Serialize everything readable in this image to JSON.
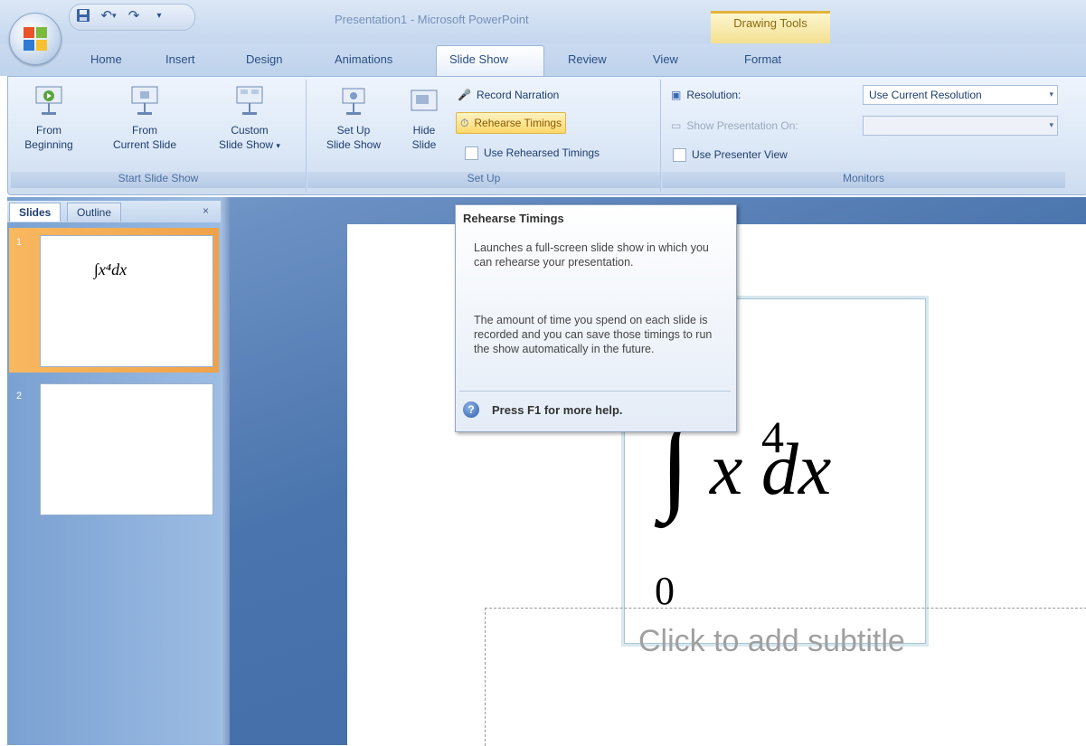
{
  "window": {
    "title": "Presentation1 - Microsoft PowerPoint",
    "contextual_tab_group": "Drawing Tools"
  },
  "quick_access": {
    "icons": [
      "save-icon",
      "undo-icon",
      "redo-icon",
      "customize-icon"
    ],
    "undo_glyph": "↶",
    "undo_arrow": "▾",
    "redo_glyph": "↷",
    "customize_glyph": "▾"
  },
  "tabs": [
    {
      "label": "Home"
    },
    {
      "label": "Insert"
    },
    {
      "label": "Design"
    },
    {
      "label": "Animations"
    },
    {
      "label": "Slide Show",
      "selected": true
    },
    {
      "label": "Review"
    },
    {
      "label": "View"
    },
    {
      "label": "Format"
    }
  ],
  "ribbon": {
    "start_slide_show": {
      "label": "Start Slide Show",
      "from_beginning_line1": "From",
      "from_beginning_line2": "Beginning",
      "from_current_line1": "From",
      "from_current_line2": "Current Slide",
      "custom_line1": "Custom",
      "custom_line2": "Slide Show",
      "custom_dropdown": "▾"
    },
    "set_up": {
      "label": "Set Up",
      "set_up_line1": "Set Up",
      "set_up_line2": "Slide Show",
      "hide_line1": "Hide",
      "hide_line2": "Slide",
      "record_narration": "Record Narration",
      "rehearse_timings": "Rehearse Timings",
      "use_rehearsed_timings": "Use Rehearsed Timings"
    },
    "monitors": {
      "label": "Monitors",
      "resolution_label": "Resolution:",
      "resolution_value": "Use Current Resolution",
      "show_presentation_on": "Show Presentation On:",
      "use_presenter_view": "Use Presenter View"
    }
  },
  "slides_pane": {
    "tab_slides": "Slides",
    "tab_outline": "Outline",
    "close_glyph": "×",
    "slides": [
      {
        "number": "1",
        "selected": true
      },
      {
        "number": "2",
        "selected": false
      }
    ]
  },
  "slide": {
    "integral_sign": "∫",
    "equation_body": "x dx",
    "exponent": "4",
    "lower_limit": "0",
    "thumb_equation": "∫x⁴dx",
    "subtitle_placeholder": "Click to add subtitle"
  },
  "tooltip": {
    "title": "Rehearse Timings",
    "paragraph1": "Launches a full-screen slide show in which you can rehearse your presentation.",
    "paragraph2": "The amount of time you spend on each slide is recorded and you can save those timings to run the show automatically in the future.",
    "help_glyph": "?",
    "help_text": "Press F1 for more help."
  },
  "colors": {
    "ribbon_accent": "#15428b",
    "selected_slide": "#f0a24a",
    "tooltip_highlight": "#ffd86b"
  }
}
